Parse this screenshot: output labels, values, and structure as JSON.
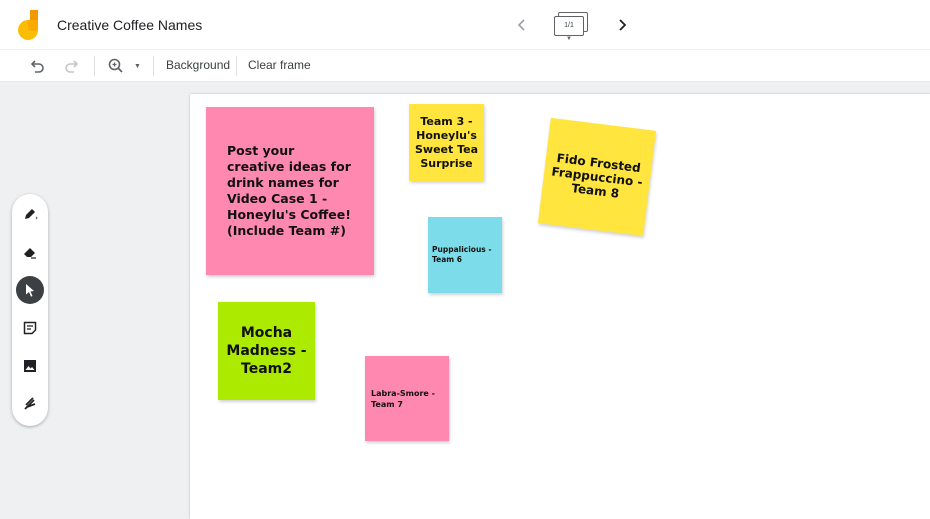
{
  "header": {
    "title": "Creative Coffee Names",
    "frame_counter": "1/1",
    "nav_prev_icon": "chevron-left-icon",
    "nav_next_icon": "chevron-right-icon"
  },
  "toolbar": {
    "background_label": "Background",
    "clear_frame_label": "Clear frame"
  },
  "tools": [
    "pen-icon",
    "eraser-icon",
    "select-icon",
    "sticky-note-icon",
    "image-icon",
    "laser-icon"
  ],
  "active_tool": "select-icon",
  "notes": [
    {
      "text": "Post your creative ideas for drink names for Video Case 1 - Honeylu's Coffee!  (Include Team #)",
      "color": "#ff88b1"
    },
    {
      "text": "Team 3 - Honeylu's Sweet Tea Surprise",
      "color": "#ffe53e"
    },
    {
      "text": "Fido Frosted Frappuccino - Team 8",
      "color": "#ffe53e"
    },
    {
      "text": "Puppalicious - Team 6",
      "color": "#7ddce9"
    },
    {
      "text": "Mocha Madness - Team2",
      "color": "#acea00"
    },
    {
      "text": "Labra-Smore - Team 7",
      "color": "#ff88b1"
    }
  ],
  "colors": {
    "accent_yellow": "#f9ab00",
    "workspace_bg": "#eef0f1"
  }
}
